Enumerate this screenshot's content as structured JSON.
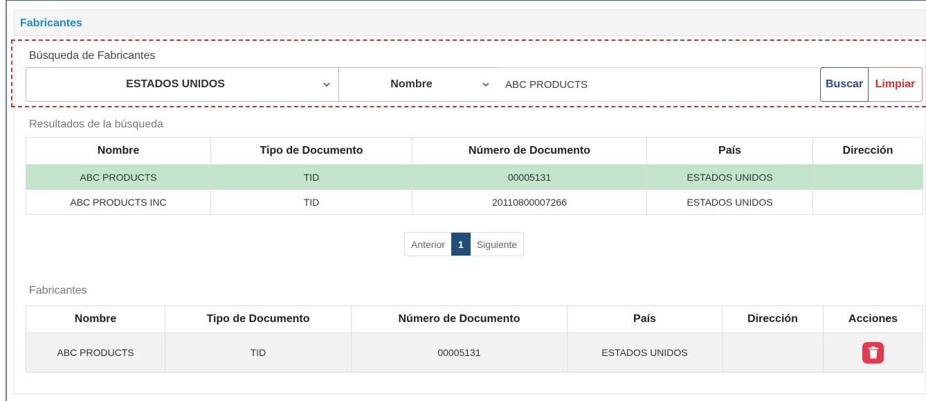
{
  "panel": {
    "title": "Fabricantes"
  },
  "search": {
    "label": "Búsqueda de Fabricantes",
    "country_value": "ESTADOS UNIDOS",
    "field_value": "Nombre",
    "query_value": "ABC PRODUCTS",
    "search_label": "Buscar",
    "clear_label": "Limpiar"
  },
  "results": {
    "label": "Resultados de la búsqueda",
    "headers": [
      "Nombre",
      "Tipo de Documento",
      "Número de Documento",
      "País",
      "Dirección"
    ],
    "rows": [
      [
        "ABC PRODUCTS",
        "TID",
        "00005131",
        "ESTADOS UNIDOS",
        ""
      ],
      [
        "ABC PRODUCTS INC",
        "TID",
        "20110800007266",
        "ESTADOS UNIDOS",
        ""
      ]
    ]
  },
  "pagination": {
    "prev": "Anterior",
    "current": "1",
    "next": "Siguiente"
  },
  "manufacturers": {
    "label": "Fabricantes",
    "headers": [
      "Nombre",
      "Tipo de Documento",
      "Número de Documento",
      "País",
      "Dirección",
      "Acciones"
    ],
    "rows": [
      [
        "ABC PRODUCTS",
        "TID",
        "00005131",
        "ESTADOS UNIDOS",
        ""
      ]
    ]
  },
  "colors": {
    "accent": "#1e88e5",
    "highlight_row": "#c3e6cb",
    "danger": "#d32f2f",
    "primary": "#2a4b93",
    "delete": "#e53950"
  },
  "icons": {
    "dropdown": "chevron-down-icon",
    "delete": "trash-icon"
  }
}
